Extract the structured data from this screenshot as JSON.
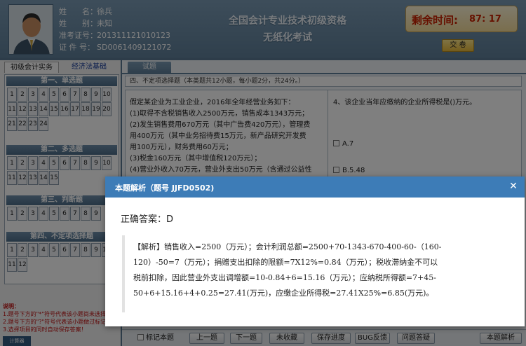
{
  "candidate": {
    "name_label": "姓　　名：",
    "name": "徐兵",
    "gender_label": "姓　　别：",
    "gender": "未知",
    "ticket_label": "准考证号：",
    "ticket": "201311121010123",
    "id_label": "证 件 号：",
    "id": "SD0061409121072"
  },
  "header": {
    "title_line1": "全国会计专业技术初级资格",
    "title_line2": "无纸化考试",
    "timer_label": "剩余时间:",
    "timer_value": "87: 17",
    "submit_label": "交 卷"
  },
  "subjects": [
    "初级会计实务",
    "经济法基础"
  ],
  "sections": [
    {
      "title": "第一、单选题",
      "numbers": [
        "1",
        "2",
        "3",
        "4",
        "5",
        "6",
        "7",
        "8",
        "9",
        "10",
        "11",
        "12",
        "13",
        "14",
        "15",
        "16",
        "17",
        "18",
        "19",
        "20",
        "21",
        "22",
        "23",
        "24"
      ]
    },
    {
      "title": "第二、多选题",
      "numbers": [
        "1",
        "2",
        "3",
        "4",
        "5",
        "6",
        "7",
        "8",
        "9",
        "10",
        "11",
        "12",
        "13",
        "14",
        "15"
      ]
    },
    {
      "title": "第三、判断题",
      "numbers": [
        "1",
        "2",
        "3",
        "4",
        "5",
        "6",
        "7",
        "8",
        "9"
      ]
    },
    {
      "title": "第四、不定项选择题",
      "numbers": [
        "1",
        "2",
        "3",
        "4",
        "5",
        "6",
        "7",
        "8",
        "9",
        "10",
        "11",
        "12"
      ]
    }
  ],
  "notes": {
    "head": "说明：",
    "line1": "1.题号下方的\"*\"符号代表该小题尚未选择",
    "line2": "2.题号下方的\"?\"符号代表该小题做过标记",
    "line3": "3.选择项目的同时自动保存答案！"
  },
  "calculator_label": "计算器",
  "question": {
    "tab_label": "试题",
    "section_desc": "四、不定项选择题（本类题共12小题，每小题2分，共24分。）",
    "stem": [
      "假定某企业为工业企业，2016年全年经营业务如下：",
      "(1)取得不含税销售收入2500万元，销售成本1343万元；",
      "(2)发生销售费用670万元（其中广告费420万元），管理费",
      "用400万元（其中业务招待费15万元，新产品研究开发费",
      "用100万元），财务费用60万元；",
      "(3)税金160万元（其中增值税120万元）；",
      "(4)营业外收入70万元，营业外支出50万元（含通过公益性"
    ],
    "text": "4、该企业当年应缴纳的企业所得税是()万元。",
    "options": [
      "A.7",
      "B.5.48"
    ]
  },
  "bottom": {
    "mark_label": "标记本题",
    "prev": "上一题",
    "next": "下一题",
    "unfav": "未收藏",
    "save": "保存进度",
    "bug": "BUG反馈",
    "faq": "问题答疑",
    "analysis": "本题解析"
  },
  "modal": {
    "title": "本题解析（题号 JJFD0502)",
    "answer": "正确答案：D",
    "analysis_lines": [
      "【解析】销售收入=2500（万元）；会计利润总额=2500+70-1343-670-400-60-（160-",
      "120）-50=7（万元）；捐赠支出扣除的限额=7X12%=0.84（万元）；税收滞纳金不可以",
      "税前扣除，因此营业外支出调增额=10-0.84+6=15.16（万元）；应纳税所得额=7+45-",
      "50+6+15.16+4+0.25=27.41(万元)，应缴企业所得税=27.41X25%=6.85(万元)。"
    ]
  }
}
